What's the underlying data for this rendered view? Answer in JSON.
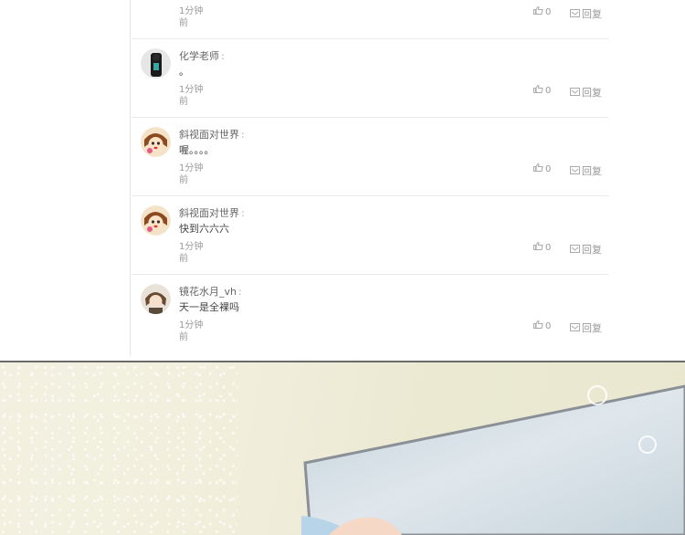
{
  "comments": [
    {
      "time": "1分钟前",
      "likes": "0",
      "reply": "回复"
    },
    {
      "user": "化学老师",
      "text": "。",
      "time": "1分钟前",
      "likes": "0",
      "reply": "回复",
      "avatar": "dark-figure-avatar"
    },
    {
      "user": "斜视面对世界",
      "text": "喔。。。。",
      "time": "1分钟前",
      "likes": "0",
      "reply": "回复",
      "avatar": "cartoon-girl-avatar"
    },
    {
      "user": "斜视面对世界",
      "text": "快到六六六",
      "time": "1分钟前",
      "likes": "0",
      "reply": "回复",
      "avatar": "cartoon-girl-avatar"
    },
    {
      "user": "镜花水月_vh",
      "text": "天一是全裸吗",
      "time": "1分钟前",
      "likes": "0",
      "reply": "回复",
      "avatar": "anime-boy-avatar"
    }
  ],
  "colors": {
    "bg": "#ffffff",
    "divider": "#6b6b6b",
    "scene": "#ebe9d2",
    "mirror": "#c7d4dc"
  }
}
